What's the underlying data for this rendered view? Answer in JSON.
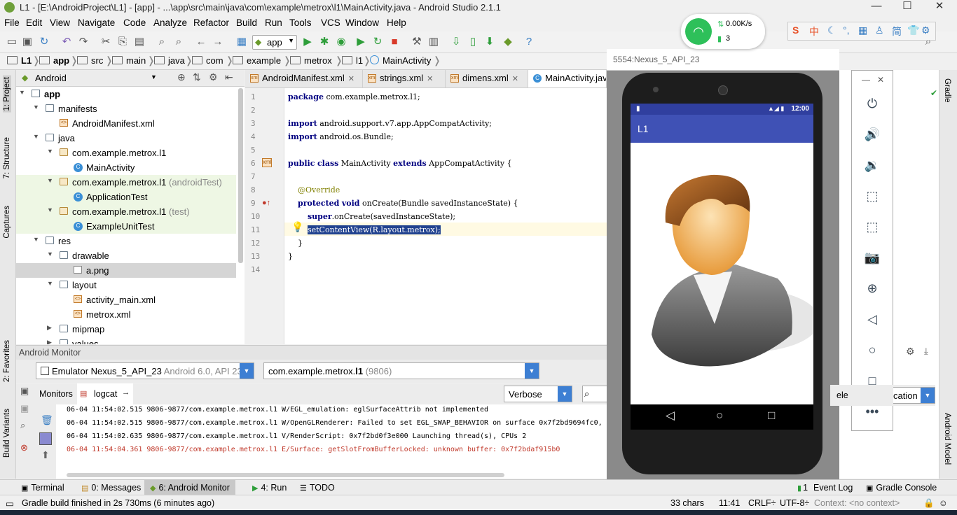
{
  "window": {
    "title": "L1 - [E:\\AndroidProject\\L1] - [app] - ...\\app\\src\\main\\java\\com\\example\\metrox\\l1\\MainActivity.java - Android Studio 2.1.1",
    "minimize": "—",
    "maximize": "☐",
    "close": "✕"
  },
  "menu": [
    "File",
    "Edit",
    "View",
    "Navigate",
    "Code",
    "Analyze",
    "Refactor",
    "Build",
    "Run",
    "Tools",
    "VCS",
    "Window",
    "Help"
  ],
  "toolbar": {
    "run_config": "app"
  },
  "breadcrumb": [
    "L1",
    "app",
    "src",
    "main",
    "java",
    "com",
    "example",
    "metrox",
    "l1",
    "MainActivity"
  ],
  "project_panel": {
    "view_selector": "Android",
    "tree": [
      {
        "label": "app",
        "bold": true,
        "indent": 0,
        "icon": "module",
        "arrow": "▼"
      },
      {
        "label": "manifests",
        "indent": 1,
        "icon": "folder",
        "arrow": "▼"
      },
      {
        "label": "AndroidManifest.xml",
        "indent": 2,
        "icon": "xml",
        "arrow": ""
      },
      {
        "label": "java",
        "indent": 1,
        "icon": "folder",
        "arrow": "▼"
      },
      {
        "label": "com.example.metrox.l1",
        "indent": 2,
        "icon": "package",
        "arrow": "▼"
      },
      {
        "label": "MainActivity",
        "indent": 3,
        "icon": "class",
        "arrow": ""
      },
      {
        "label": "com.example.metrox.l1",
        "suffix": " (androidTest)",
        "indent": 2,
        "icon": "package",
        "arrow": "▼",
        "green": true
      },
      {
        "label": "ApplicationTest",
        "indent": 3,
        "icon": "class",
        "arrow": "",
        "green": true
      },
      {
        "label": "com.example.metrox.l1",
        "suffix": " (test)",
        "indent": 2,
        "icon": "package",
        "arrow": "▼",
        "green": true
      },
      {
        "label": "ExampleUnitTest",
        "indent": 3,
        "icon": "class",
        "arrow": "",
        "green": true
      },
      {
        "label": "res",
        "indent": 1,
        "icon": "folder",
        "arrow": "▼"
      },
      {
        "label": "drawable",
        "indent": 2,
        "icon": "folder",
        "arrow": "▼"
      },
      {
        "label": "a.png",
        "indent": 3,
        "icon": "png",
        "arrow": "",
        "selected": true
      },
      {
        "label": "layout",
        "indent": 2,
        "icon": "folder",
        "arrow": "▼"
      },
      {
        "label": "activity_main.xml",
        "indent": 3,
        "icon": "xml",
        "arrow": ""
      },
      {
        "label": "metrox.xml",
        "indent": 3,
        "icon": "xml",
        "arrow": ""
      },
      {
        "label": "mipmap",
        "indent": 2,
        "icon": "folder",
        "arrow": "▶"
      },
      {
        "label": "values",
        "indent": 2,
        "icon": "folder",
        "arrow": "▶"
      }
    ]
  },
  "left_strip": [
    "1: Project",
    "7: Structure",
    "Captures",
    "2: Favorites",
    "Build Variants"
  ],
  "right_strip": [
    "Gradle",
    "Android Model"
  ],
  "editor_tabs": [
    {
      "label": "AndroidManifest.xml",
      "icon": "xml"
    },
    {
      "label": "strings.xml",
      "icon": "xml"
    },
    {
      "label": "dimens.xml",
      "icon": "xml"
    },
    {
      "label": "MainActivity.java",
      "icon": "class",
      "active": true
    }
  ],
  "code_lines": [
    {
      "n": "1",
      "text": "package com.example.metrox.l1;"
    },
    {
      "n": "2",
      "text": ""
    },
    {
      "n": "3",
      "text": "import android.support.v7.app.AppCompatActivity;"
    },
    {
      "n": "4",
      "text": "import android.os.Bundle;"
    },
    {
      "n": "5",
      "text": ""
    },
    {
      "n": "6",
      "text": "public class MainActivity extends AppCompatActivity {"
    },
    {
      "n": "7",
      "text": ""
    },
    {
      "n": "8",
      "text": "    @Override"
    },
    {
      "n": "9",
      "text": "    protected void onCreate(Bundle savedInstanceState) {"
    },
    {
      "n": "10",
      "text": "        super.onCreate(savedInstanceState);"
    },
    {
      "n": "11",
      "text": "        setContentView(R.layout.metrox);"
    },
    {
      "n": "12",
      "text": "    }"
    },
    {
      "n": "13",
      "text": "}"
    },
    {
      "n": "14",
      "text": ""
    }
  ],
  "monitor": {
    "title": "Android Monitor",
    "device": "Emulator Nexus_5_API_23",
    "device_suffix": " Android 6.0, API 23",
    "process": "com.example.metrox.",
    "process_bold": "l1",
    "process_suffix": " (9806)",
    "tabs": [
      "Monitors",
      "logcat"
    ],
    "level": "Verbose",
    "filter_partial_1": "ele",
    "filter_partial_2": "cation",
    "log_lines": [
      {
        "text": "06-04 11:54:02.515 9806-9877/com.example.metrox.l1 W/EGL_emulation: eglSurfaceAttrib not implemented",
        "color": "#000"
      },
      {
        "text": "06-04 11:54:02.515 9806-9877/com.example.metrox.l1 W/OpenGLRenderer: Failed to set EGL_SWAP_BEHAVIOR on surface 0x7f2bd9694fc0, e",
        "color": "#000"
      },
      {
        "text": "06-04 11:54:02.635 9806-9877/com.example.metrox.l1 V/RenderScript: 0x7f2bd0f3e000 Launching thread(s), CPUs 2",
        "color": "#000"
      },
      {
        "text": "06-04 11:54:04.361 9806-9877/com.example.metrox.l1 E/Surface: getSlotFromBufferLocked: unknown buffer: 0x7f2bdaf915b0",
        "color": "#c0392b"
      }
    ]
  },
  "bottom_tabs": {
    "terminal": "Terminal",
    "messages": "0: Messages",
    "monitor": "6: Android Monitor",
    "run": "4: Run",
    "todo": "TODO",
    "event_log": "Event Log",
    "event_log_num": "1",
    "gradle_console": "Gradle Console"
  },
  "status": {
    "message": "Gradle build finished in 2s 730ms (6 minutes ago)",
    "chars": "33 chars",
    "position": "11:41",
    "line_sep": "CRLF÷",
    "encoding": "UTF-8÷",
    "context": "Context: <no context>"
  },
  "emulator": {
    "title": "5554:Nexus_5_API_23",
    "time": "12:00",
    "app_title": "L1"
  },
  "network_widget": {
    "speed": "0.00K/s",
    "count": "3"
  },
  "ime_bar": [
    "中",
    "简"
  ]
}
